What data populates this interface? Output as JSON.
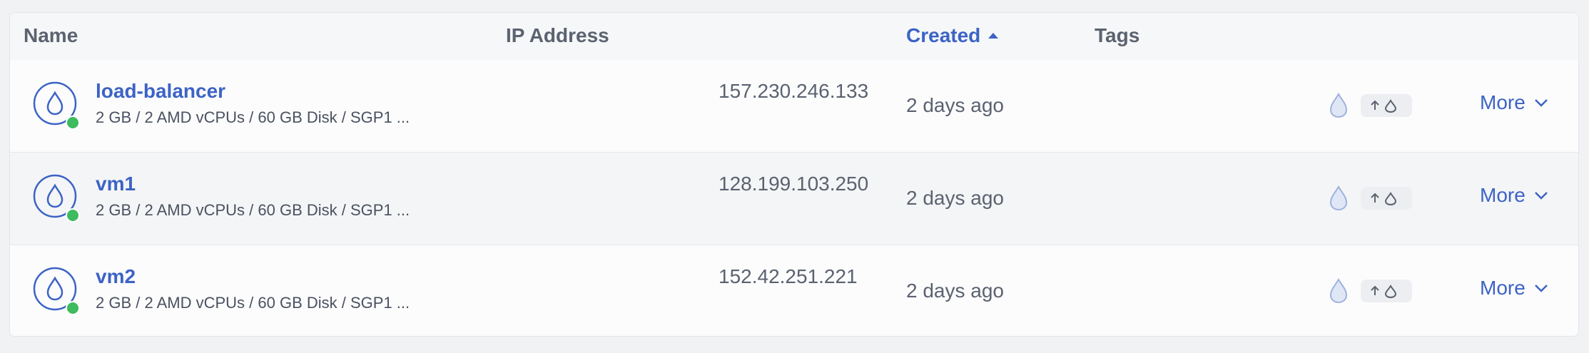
{
  "table": {
    "columns": {
      "name": "Name",
      "ip": "IP Address",
      "created": "Created",
      "tags": "Tags"
    },
    "sort": {
      "column": "created",
      "direction": "ascending",
      "indicator_icon": "caret-up-icon"
    },
    "rows": [
      {
        "name": "load-balancer",
        "description": "2 GB / 2 AMD vCPUs / 60 GB Disk / SGP1 ...",
        "ip": "157.230.246.133",
        "created": "2 days ago",
        "status": "running",
        "more_label": "More"
      },
      {
        "name": "vm1",
        "description": "2 GB / 2 AMD vCPUs / 60 GB Disk / SGP1 ...",
        "ip": "128.199.103.250",
        "created": "2 days ago",
        "status": "running",
        "more_label": "More"
      },
      {
        "name": "vm2",
        "description": "2 GB / 2 AMD vCPUs / 60 GB Disk / SGP1 ...",
        "ip": "152.42.251.221",
        "created": "2 days ago",
        "status": "running",
        "more_label": "More"
      }
    ]
  },
  "colors": {
    "link": "#3c63c5",
    "status_running": "#3dbb5e",
    "text_muted": "#5b6270"
  },
  "icons": {
    "droplet": "droplet-icon",
    "resize": "upgrade-icon",
    "more": "chevron-down-icon"
  }
}
